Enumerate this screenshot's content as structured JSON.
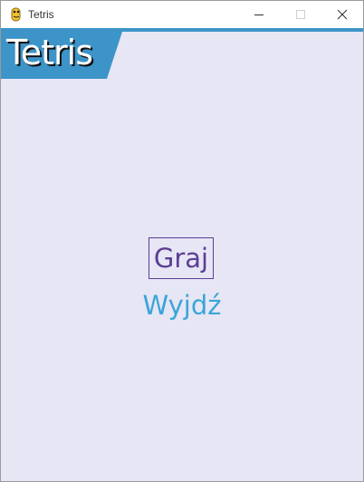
{
  "window": {
    "title": "Tetris",
    "icon": "python-icon"
  },
  "header": {
    "title": "Tetris",
    "band_color": "#3c94c8"
  },
  "menu": {
    "play_label": "Graj",
    "quit_label": "Wyjdź",
    "play_color": "#5c3e94",
    "quit_color": "#3aa6d8"
  },
  "colors": {
    "background": "#e6e6f5"
  }
}
